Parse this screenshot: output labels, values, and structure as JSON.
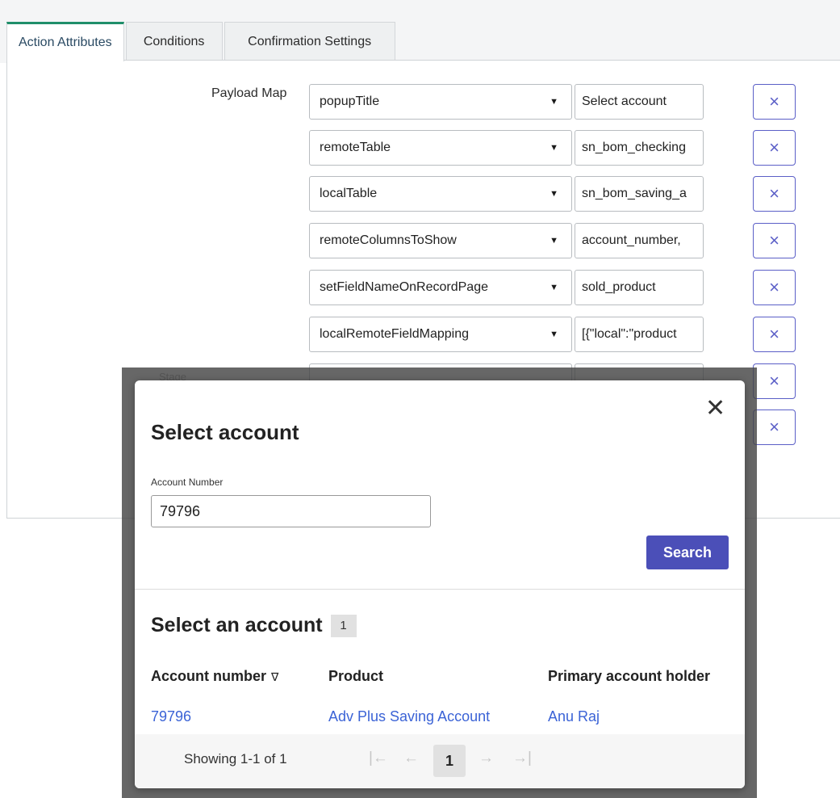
{
  "tabs": [
    "Action Attributes",
    "Conditions",
    "Confirmation Settings"
  ],
  "payload_label": "Payload Map",
  "stage_label": "Stage",
  "rows": [
    {
      "key": "popupTitle",
      "value": "Select account"
    },
    {
      "key": "remoteTable",
      "value": "sn_bom_checking"
    },
    {
      "key": "localTable",
      "value": "sn_bom_saving_a"
    },
    {
      "key": "remoteColumnsToShow",
      "value": "account_number,"
    },
    {
      "key": "setFieldNameOnRecordPage",
      "value": "sold_product"
    },
    {
      "key": "localRemoteFieldMapping",
      "value": "[{\"local\":\"product"
    }
  ],
  "remove_icon": "×",
  "caret_icon": "▼",
  "modal": {
    "close_icon": "✕",
    "title": "Select account",
    "field_label": "Account Number",
    "field_value": "79796",
    "search_label": "Search",
    "subtitle": "Select an account",
    "count": "1",
    "columns": [
      "Account number",
      "Product",
      "Primary account holder"
    ],
    "filter_icon": "∇",
    "row": {
      "account_number": "79796",
      "product": "Adv Plus Saving Account",
      "holder": "Anu Raj"
    },
    "showing": "Showing 1-1 of 1",
    "page": "1",
    "first_icon": "|←",
    "prev_icon": "←",
    "next_icon": "→",
    "last_icon": "→|"
  },
  "colors": {
    "accent": "#4b4fb8",
    "tab_active": "#1f8f6a",
    "link": "#3b63d6"
  }
}
